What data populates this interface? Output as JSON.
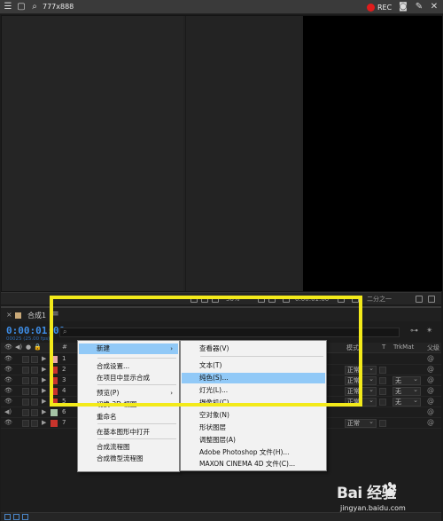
{
  "capture_bar": {
    "size_label": "777x888",
    "rec_label": "REC",
    "icons": [
      "menu-icon",
      "window-icon",
      "search-icon",
      "rec-dot-icon",
      "camera-icon",
      "pen-icon",
      "close-icon"
    ]
  },
  "viewer_toolbar": {
    "zoom": "50%",
    "timecode": "0:00:01:00",
    "resolution": "二分之一"
  },
  "timeline": {
    "tab_label": "合成1",
    "timecode": "0:00:01:00",
    "timecode_sub": "00025 (25.00 fps)",
    "columns": {
      "hash": "#",
      "mode": "模式",
      "t": "T",
      "trkmat": "TrkMat",
      "parent": "父级"
    },
    "layers": [
      {
        "num": "1",
        "label_color": "#e6a6a6",
        "mode": "",
        "trkmat": ""
      },
      {
        "num": "2",
        "label_color": "#c8342c",
        "mode": "正常",
        "trkmat": ""
      },
      {
        "num": "3",
        "label_color": "#c8342c",
        "mode": "正常",
        "trkmat": "无"
      },
      {
        "num": "4",
        "label_color": "#c8342c",
        "mode": "正常",
        "trkmat": "无"
      },
      {
        "num": "5",
        "label_color": "#c8342c",
        "mode": "正常",
        "trkmat": "无"
      },
      {
        "num": "6",
        "label_color": "#a6c4a6",
        "mode": "",
        "trkmat": ""
      },
      {
        "num": "7",
        "label_color": "#c8342c",
        "mode": "正常",
        "trkmat": ""
      }
    ]
  },
  "context_menu": {
    "items": [
      {
        "label": "新建",
        "has_submenu": true,
        "highlighted": true
      },
      {
        "label": "合成设置..."
      },
      {
        "label": "在项目中显示合成"
      },
      {
        "label": "预览(P)",
        "has_submenu": true
      },
      {
        "label": "切换 3D 视图"
      },
      {
        "label": "重命名"
      },
      {
        "label": "在基本图形中打开"
      },
      {
        "label": "合成流程图"
      },
      {
        "label": "合成微型流程图"
      }
    ]
  },
  "submenu": {
    "items": [
      {
        "label": "查看器(V)"
      },
      {
        "label": "文本(T)"
      },
      {
        "label": "纯色(S)...",
        "highlighted": true
      },
      {
        "label": "灯光(L)..."
      },
      {
        "label": "摄像机(C)..."
      },
      {
        "label": "空对象(N)"
      },
      {
        "label": "形状图层"
      },
      {
        "label": "调整图层(A)"
      },
      {
        "label": "Adobe Photoshop 文件(H)..."
      },
      {
        "label": "MAXON CINEMA 4D 文件(C)..."
      }
    ]
  },
  "watermark": {
    "logo": "Bai 经验",
    "url": "jingyan.baidu.com"
  },
  "colors": {
    "accent": "#3e8ee8",
    "highlight": "#91c9f7",
    "annotation": "#f3ea1a",
    "rec": "#e01c1c"
  }
}
